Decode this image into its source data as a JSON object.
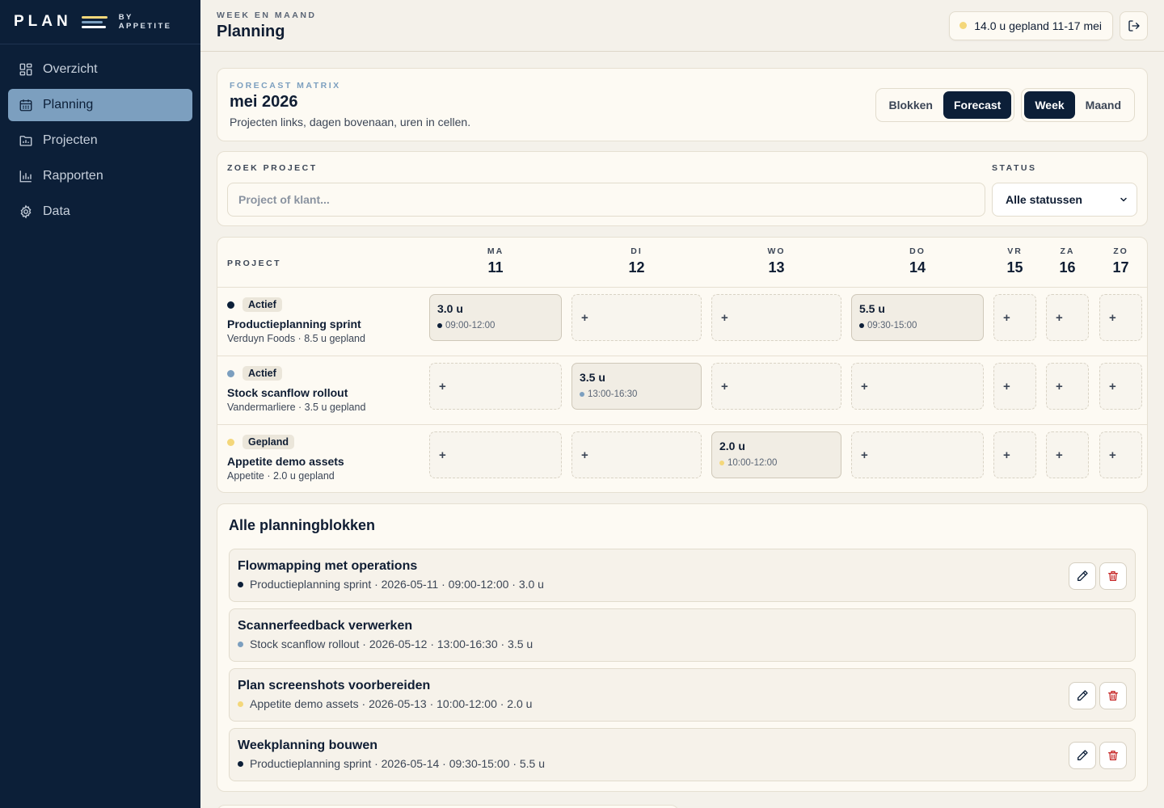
{
  "brand": {
    "name": "PLAN",
    "by_line1": "BY",
    "by_line2": "APPETITE",
    "line_colors": [
      "#f4d77a",
      "#7c9fbf",
      "#ffffff"
    ]
  },
  "sidebar": {
    "items": [
      {
        "label": "Overzicht",
        "icon": "grid-icon",
        "active": false
      },
      {
        "label": "Planning",
        "icon": "calendar-icon",
        "active": true
      },
      {
        "label": "Projecten",
        "icon": "folder-icon",
        "active": false
      },
      {
        "label": "Rapporten",
        "icon": "bar-chart-icon",
        "active": false
      },
      {
        "label": "Data",
        "icon": "gear-icon",
        "active": false
      }
    ]
  },
  "header": {
    "kicker": "WEEK EN MAAND",
    "title": "Planning",
    "hours_pill": "14.0 u gepland 11-17 mei",
    "pill_dot_color": "#f4d77a"
  },
  "forecast": {
    "kicker": "FORECAST MATRIX",
    "month": "mei 2026",
    "subtitle": "Projecten links, dagen bovenaan, uren in cellen.",
    "mode_toggle": [
      "Blokken",
      "Forecast"
    ],
    "mode_active": "Forecast",
    "range_toggle": [
      "Week",
      "Maand"
    ],
    "range_active": "Week"
  },
  "filters": {
    "search_label": "ZOEK PROJECT",
    "search_placeholder": "Project of klant...",
    "status_label": "STATUS",
    "status_value": "Alle statussen"
  },
  "matrix": {
    "project_col": "PROJECT",
    "days": [
      {
        "name": "MA",
        "num": "11"
      },
      {
        "name": "DI",
        "num": "12"
      },
      {
        "name": "WO",
        "num": "13"
      },
      {
        "name": "DO",
        "num": "14"
      },
      {
        "name": "VR",
        "num": "15"
      },
      {
        "name": "ZA",
        "num": "16"
      },
      {
        "name": "ZO",
        "num": "17"
      }
    ],
    "add_symbol": "+",
    "rows": [
      {
        "status": "Actief",
        "dot_color": "#0c1f38",
        "name": "Productieplanning sprint",
        "meta": "Verduyn Foods · 8.5 u gepland",
        "cells": [
          {
            "day": 0,
            "hours": "3.0 u",
            "time": "09:00-12:00"
          },
          {
            "day": 3,
            "hours": "5.5 u",
            "time": "09:30-15:00"
          }
        ]
      },
      {
        "status": "Actief",
        "dot_color": "#7c9fbf",
        "name": "Stock scanflow rollout",
        "meta": "Vandermarliere · 3.5 u gepland",
        "cells": [
          {
            "day": 1,
            "hours": "3.5 u",
            "time": "13:00-16:30"
          }
        ]
      },
      {
        "status": "Gepland",
        "dot_color": "#f4d77a",
        "name": "Appetite demo assets",
        "meta": "Appetite · 2.0 u gepland",
        "cells": [
          {
            "day": 2,
            "hours": "2.0 u",
            "time": "10:00-12:00"
          }
        ]
      }
    ]
  },
  "blocks": {
    "title": "Alle planningblokken",
    "items": [
      {
        "title": "Flowmapping met operations",
        "meta": "Productieplanning sprint · 2026-05-11 · 09:00-12:00 · 3.0 u",
        "dot_color": "#0c1f38",
        "actions": true
      },
      {
        "title": "Scannerfeedback verwerken",
        "meta": "Stock scanflow rollout · 2026-05-12 · 13:00-16:30 · 3.5 u",
        "dot_color": "#7c9fbf",
        "actions": false
      },
      {
        "title": "Plan screenshots voorbereiden",
        "meta": "Appetite demo assets · 2026-05-13 · 10:00-12:00 · 2.0 u",
        "dot_color": "#f4d77a",
        "actions": true
      },
      {
        "title": "Weekplanning bouwen",
        "meta": "Productieplanning sprint · 2026-05-14 · 09:30-15:00 · 5.5 u",
        "dot_color": "#0c1f38",
        "actions": true
      }
    ]
  },
  "colors": {
    "navy": "#0c1f38",
    "accent_blue": "#7c9fbf",
    "yellow": "#f4d77a",
    "danger": "#c62828"
  }
}
